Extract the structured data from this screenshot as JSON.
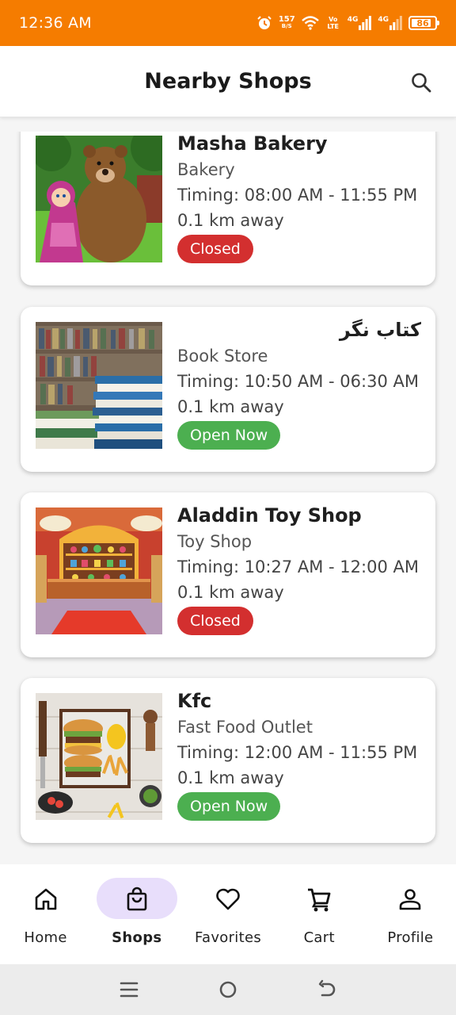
{
  "status_bar": {
    "time": "12:36 AM",
    "speed_value": "157",
    "speed_unit": "B/S",
    "volte": "Vo LTE",
    "net1": "4G",
    "net2": "4G",
    "battery": "86",
    "battery_level": 0.86
  },
  "app_bar": {
    "title": "Nearby Shops",
    "search_icon": "search-icon"
  },
  "shops": [
    {
      "name": "Masha Bakery",
      "category": "Bakery",
      "timing": "Timing: 08:00 AM - 11:55 PM",
      "distance": "0.1 km away",
      "status": "Closed",
      "image": "cartoon-bear-girl-image"
    },
    {
      "name": "کتاب نگر",
      "category": "Book Store",
      "timing": "Timing: 10:50 AM - 06:30 AM",
      "distance": "0.1 km away",
      "status": "Open Now",
      "image": "books-shelf-image"
    },
    {
      "name": "Aladdin Toy Shop",
      "category": "Toy Shop",
      "timing": "Timing: 10:27 AM - 12:00 AM",
      "distance": "0.1 km away",
      "status": "Closed",
      "image": "toy-shop-interior-image"
    },
    {
      "name": "Kfc",
      "category": "Fast Food Outlet",
      "timing": "Timing: 12:00 AM - 11:55 PM",
      "distance": "0.1 km away",
      "status": "Open Now",
      "image": "burger-fries-image"
    }
  ],
  "bottom_nav": {
    "items": [
      {
        "label": "Home",
        "icon": "home-icon",
        "active": false
      },
      {
        "label": "Shops",
        "icon": "shopping-bag-icon",
        "active": true
      },
      {
        "label": "Favorites",
        "icon": "heart-icon",
        "active": false
      },
      {
        "label": "Cart",
        "icon": "cart-icon",
        "active": false
      },
      {
        "label": "Profile",
        "icon": "person-icon",
        "active": false
      }
    ]
  },
  "colors": {
    "status_bar": "#f57c00",
    "closed": "#d32f2f",
    "open": "#4caf50",
    "active_pill": "#e8defb"
  }
}
